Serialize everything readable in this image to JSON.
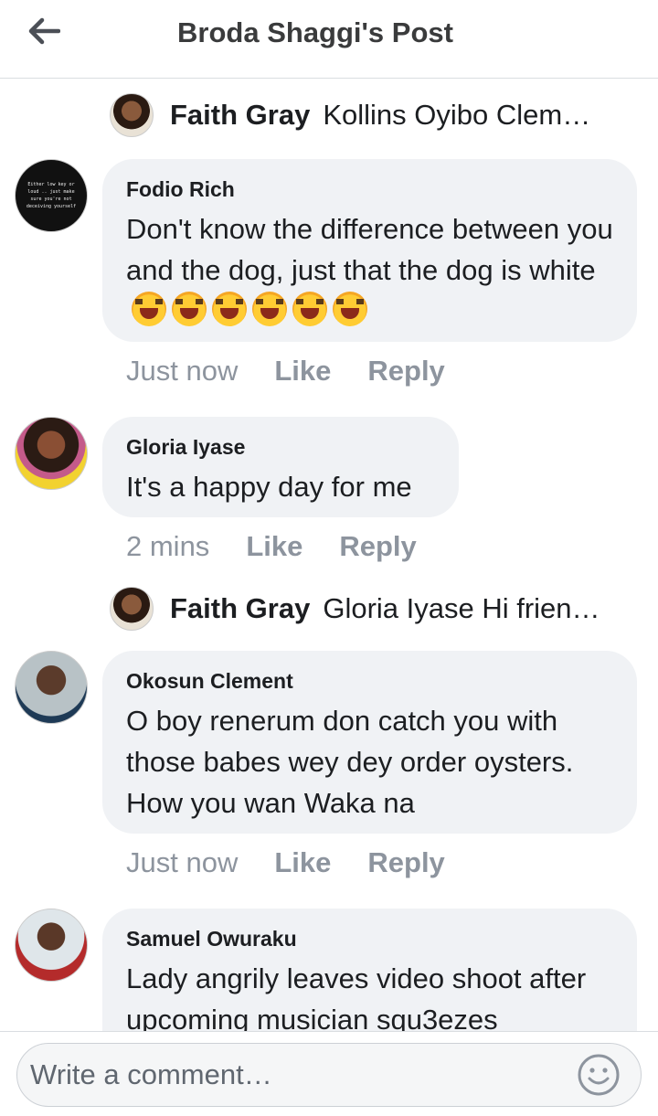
{
  "header": {
    "title": "Broda Shaggi's Post"
  },
  "feed": {
    "reply_preview_1": {
      "name": "Faith Gray",
      "text": "Kollins Oyibo Clem…"
    },
    "comment_1": {
      "author": "Fodio Rich",
      "text": "Don't know the difference between you and the dog, just that the dog is white",
      "avatar_text": "Either low key or loud .. just make sure you're not deceiving yourself",
      "emoji_count": 6,
      "time": "Just now",
      "like": "Like",
      "reply": "Reply"
    },
    "comment_2": {
      "author": "Gloria Iyase",
      "text": "It's a happy day for me",
      "time": "2 mins",
      "like": "Like",
      "reply": "Reply"
    },
    "reply_preview_2": {
      "name": "Faith Gray",
      "text": "Gloria Iyase Hi frien…"
    },
    "comment_3": {
      "author": "Okosun Clement",
      "text": "O boy renerum don catch you with those babes wey dey order oysters. How you wan Waka na",
      "time": "Just now",
      "like": "Like",
      "reply": "Reply"
    },
    "comment_4": {
      "author": "Samuel Owuraku",
      "text": "Lady angrily leaves video shoot after upcoming musician squ3ezes"
    }
  },
  "composer": {
    "placeholder": "Write a comment…"
  }
}
